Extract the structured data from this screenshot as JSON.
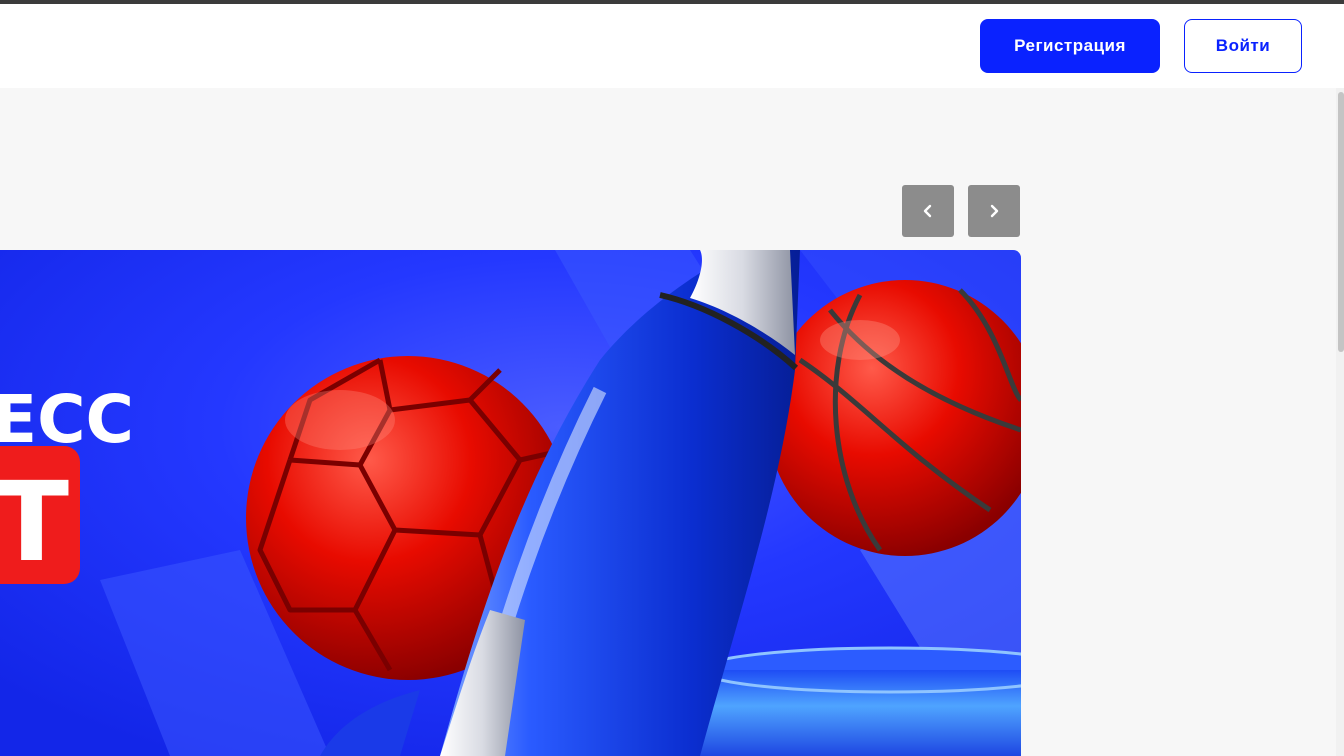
{
  "header": {
    "register_label": "Регистрация",
    "login_label": "Войти"
  },
  "carousel": {
    "prev_icon": "chevron-left-icon",
    "next_icon": "chevron-right-icon",
    "banner": {
      "text_fragment": "ЕСС",
      "badge_fragment": "Т"
    }
  },
  "colors": {
    "accent": "#0a22ff",
    "banner_blue": "#1f34ff",
    "ball_red": "#e00000",
    "nav_gray": "#8c8c8c"
  }
}
